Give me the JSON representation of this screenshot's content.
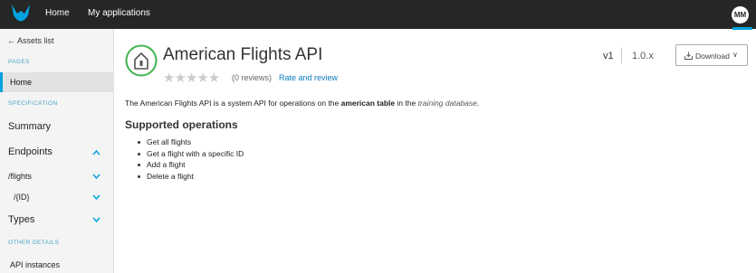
{
  "topbar": {
    "logo_icon": "mulesoft-logo-icon",
    "nav": {
      "home": "Home",
      "my_applications": "My applications"
    },
    "avatar_initials": "MM",
    "accent_color": "#00a2df"
  },
  "sidebar": {
    "back_link": "← Assets list",
    "sections": {
      "pages": "PAGES",
      "specification": "SPECIFICATION",
      "other_details": "OTHER DETAILS"
    },
    "pages": {
      "home": "Home"
    },
    "spec_items": {
      "summary": "Summary",
      "endpoints": "Endpoints",
      "flights": "/flights",
      "id": "/{ID}",
      "types": "Types"
    },
    "other": {
      "api_instances": "API instances"
    }
  },
  "main": {
    "api_icon": "api-building-icon",
    "title": "American Flights API",
    "rating": {
      "stars": "★★★★★",
      "reviews": "(0 reviews)",
      "rate_link": "Rate and review"
    },
    "version": {
      "major": "v1",
      "range": "1.0.x"
    },
    "download_label": "Download",
    "description": {
      "pre": "The American Flights API is a system API for operations on the ",
      "bold": "american table",
      "mid": " in the ",
      "italic": "training database",
      "post": "."
    },
    "supported_operations_title": "Supported operations",
    "operations": [
      "Get all flights",
      "Get a flight with a specific ID",
      "Add a flight",
      "Delete a flight"
    ]
  }
}
